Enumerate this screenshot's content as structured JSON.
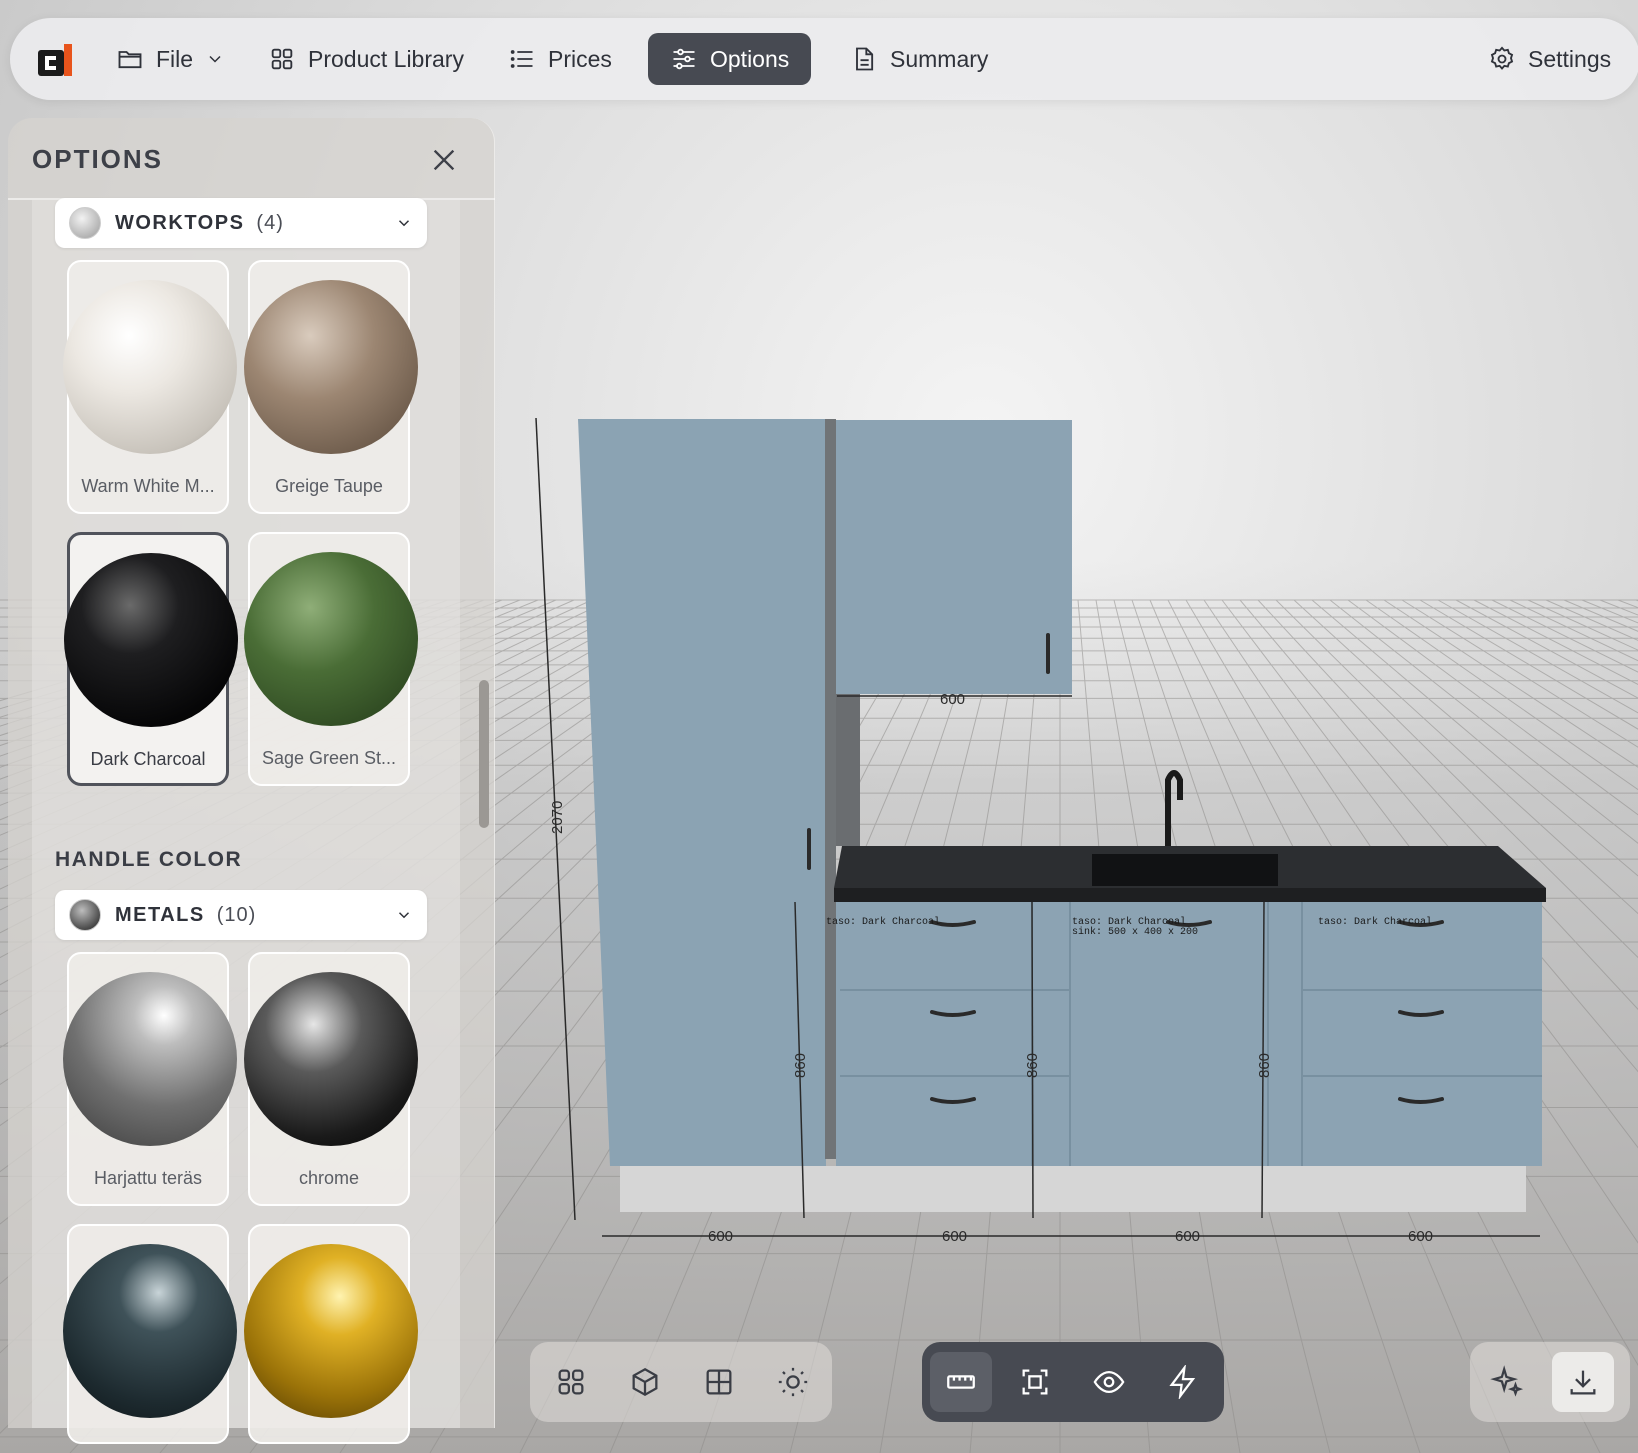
{
  "toolbar": {
    "logo_text": "c",
    "file_label": "File",
    "product_library_label": "Product Library",
    "prices_label": "Prices",
    "options_label": "Options",
    "summary_label": "Summary",
    "settings_label": "Settings",
    "active_tab": "Options"
  },
  "panel": {
    "title": "OPTIONS",
    "worktops": {
      "label": "WORKTOPS",
      "count": "(4)",
      "materials": [
        {
          "name": "Warm White M...",
          "color": "#e6e2dc",
          "selected": false
        },
        {
          "name": "Greige Taupe",
          "color": "#8e7a68",
          "selected": false
        },
        {
          "name": "Dark Charcoal",
          "color": "#0c0c0e",
          "selected": true
        },
        {
          "name": "Sage Green St...",
          "color": "#3c5a2c",
          "selected": false
        }
      ]
    },
    "handle_color": {
      "heading": "HANDLE COLOR",
      "label": "METALS",
      "count": "(10)",
      "materials": [
        {
          "name": "Harjattu teräs",
          "color": "#8a8a8a"
        },
        {
          "name": "chrome",
          "color": "#2a2a2a"
        },
        {
          "name": "",
          "color": "#2a3a40"
        },
        {
          "name": "",
          "color": "#b88a10"
        }
      ]
    }
  },
  "scene": {
    "cabinet_color": "#8ba3b3",
    "worktop_color": "#2c2e31",
    "plinth_color": "#d6d6d6",
    "dimensions": {
      "tall_height": "2070",
      "wall_width": "600",
      "base_heights": [
        "860",
        "860",
        "860"
      ],
      "base_widths": [
        "600",
        "600",
        "600",
        "600"
      ]
    },
    "cabinet_labels": [
      "taso: Dark Charcoal",
      "taso: Dark Charcoal",
      "sink:  500 x 400 x 200",
      "taso: Dark Charcoal"
    ]
  },
  "bottom_toolbar": {
    "view_tools": [
      "grid-view-icon",
      "cube-icon",
      "layout-icon",
      "sun-icon"
    ],
    "measure_tools": [
      "ruler-icon",
      "focus-frame-icon",
      "eye-icon",
      "lightning-icon"
    ],
    "actions": [
      "sparkle-icon",
      "download-icon"
    ]
  }
}
